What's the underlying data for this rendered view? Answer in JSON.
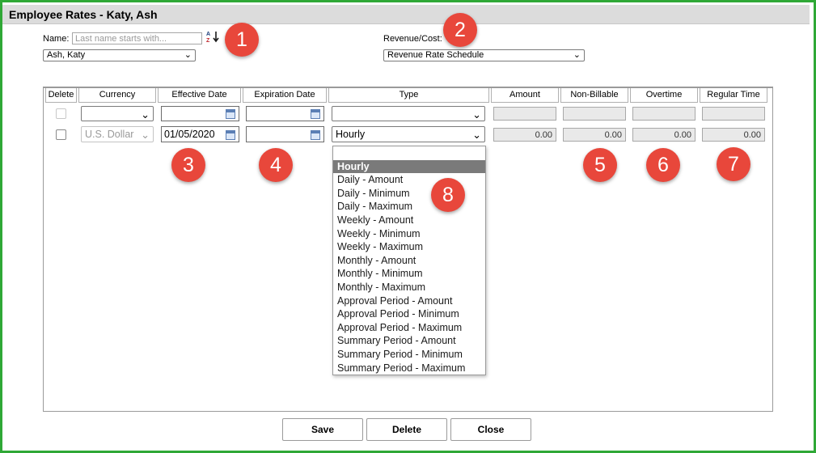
{
  "window": {
    "title": "Employee Rates - Katy, Ash"
  },
  "filters": {
    "name_label": "Name:",
    "name_placeholder": "Last name starts with...",
    "name_selected": "Ash, Katy",
    "revenue_label": "Revenue/Cost:",
    "revenue_selected": "Revenue Rate Schedule"
  },
  "table": {
    "headers": [
      "Delete",
      "Currency",
      "Effective Date",
      "Expiration Date",
      "Type",
      "Amount",
      "Non-Billable",
      "Overtime",
      "Regular Time"
    ],
    "row1": {
      "currency": "",
      "effective_date": "",
      "expiration_date": "",
      "type": ""
    },
    "row2": {
      "currency": "U.S. Dollar",
      "effective_date": "01/05/2020",
      "expiration_date": "",
      "type": "Hourly",
      "amount": "0.00",
      "non_billable": "0.00",
      "overtime": "0.00",
      "regular_time": "0.00"
    }
  },
  "type_dropdown": {
    "options": [
      "",
      "Hourly",
      "Daily - Amount",
      "Daily - Minimum",
      "Daily - Maximum",
      "Weekly - Amount",
      "Weekly - Minimum",
      "Weekly - Maximum",
      "Monthly - Amount",
      "Monthly - Minimum",
      "Monthly - Maximum",
      "Approval Period - Amount",
      "Approval Period - Minimum",
      "Approval Period - Maximum",
      "Summary Period - Amount",
      "Summary Period - Minimum",
      "Summary Period - Maximum"
    ],
    "selected": "Hourly"
  },
  "badges": [
    "1",
    "2",
    "3",
    "4",
    "5",
    "6",
    "7",
    "8"
  ],
  "buttons": {
    "save": "Save",
    "delete": "Delete",
    "close": "Close"
  },
  "colors": {
    "frame": "#2fa836",
    "badge": "#e8473b",
    "selected_option": "#7a7a7a"
  },
  "icons": {
    "sort": "sort-az-icon",
    "calendar": "calendar-icon",
    "chevron": "chevron-down-icon"
  }
}
